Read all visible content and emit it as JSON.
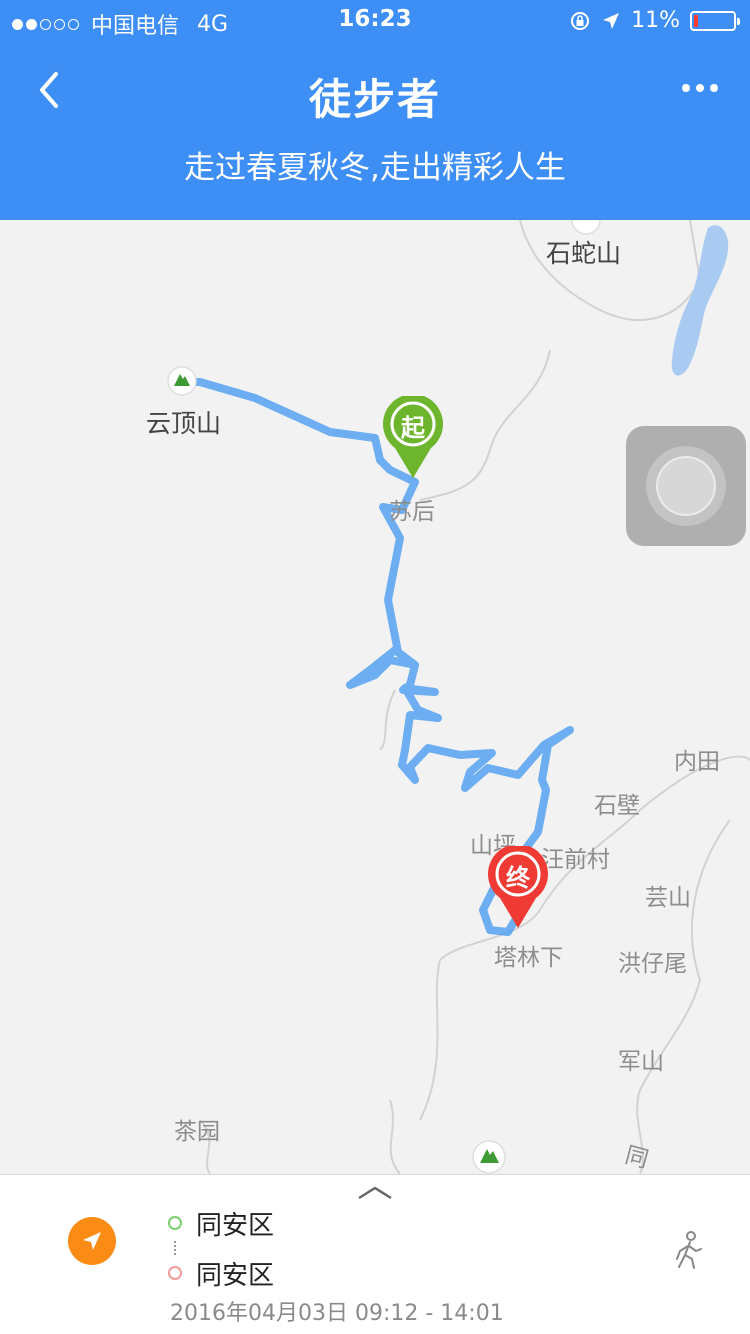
{
  "status_bar": {
    "carrier": "中国电信",
    "network": "4G",
    "time": "16:23",
    "battery": "11%",
    "battery_level": 0.11
  },
  "header": {
    "title": "徒步者",
    "subtitle": "走过春夏秋冬,走出精彩人生",
    "back_icon": "chevron-left-icon",
    "more_icon": "more-dots-icon"
  },
  "map": {
    "labels": {
      "shisheshan": "石蛇山",
      "yundingshan": "云顶山",
      "cenhou": "苏后",
      "neitian": "内田",
      "shibi": "石壁",
      "shanping": "山坪",
      "wangqiancun": "汪前村",
      "yunshan": "芸山",
      "linxia": "塔林下",
      "hongzaiwei": "洪仔尾",
      "junshan": "军山",
      "chayuan": "茶园",
      "tong": "同"
    },
    "start_marker": "起",
    "end_marker": "终",
    "colors": {
      "route": "#4a9cf0",
      "start": "#6cb52d",
      "end": "#ef3b33",
      "water": "#a9cbf2"
    }
  },
  "trip": {
    "start_place": "同安区",
    "end_place": "同安区",
    "datetime": "2016年04月03日 09:12 - 14:01"
  }
}
